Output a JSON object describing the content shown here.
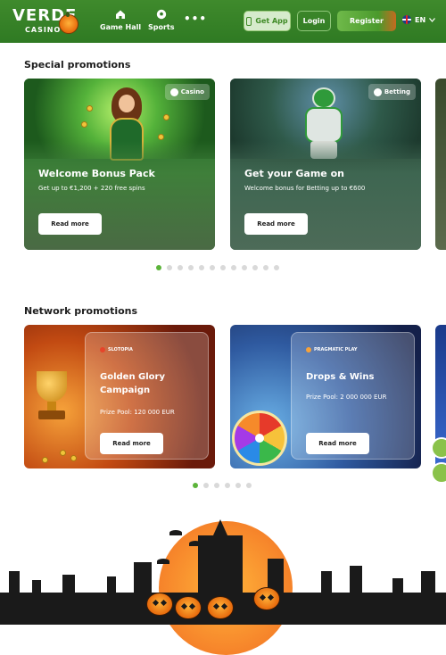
{
  "header": {
    "logo_text": "VERDE",
    "logo_sub": "CASINO",
    "nav": [
      {
        "label": "Game Hall",
        "icon": "home-icon"
      },
      {
        "label": "Sports",
        "icon": "soccer-ball-icon"
      }
    ],
    "more_label": "•••",
    "get_app_label": "Get App",
    "login_label": "Login",
    "register_label": "Register",
    "language": "EN",
    "language_icon": "uk-flag-icon"
  },
  "special": {
    "title": "Special promotions",
    "cards": [
      {
        "tag": "Casino",
        "title": "Welcome Bonus Pack",
        "desc": "Get up to €1,200 + 220 free spins",
        "button": "Read more"
      },
      {
        "tag": "Betting",
        "title": "Get your Game on",
        "desc": "Welcome bonus for Betting up to €600",
        "button": "Read more"
      }
    ],
    "pagination_count": 12,
    "active_page": 1
  },
  "network": {
    "title": "Network promotions",
    "cards": [
      {
        "provider": "SLOTOPIA",
        "title": "Golden Glory Campaign",
        "desc": "Prize Pool: 120 000 EUR",
        "button": "Read more"
      },
      {
        "provider": "PRAGMATIC PLAY",
        "title": "Drops & Wins",
        "desc": "Prize Pool: 2 000 000 EUR",
        "button": "Read more"
      }
    ],
    "pagination_count": 6,
    "active_page": 1
  },
  "colors": {
    "brand_green": "#3f8a2c",
    "accent_green": "#5cb43a",
    "pumpkin_orange": "#f6832a"
  }
}
